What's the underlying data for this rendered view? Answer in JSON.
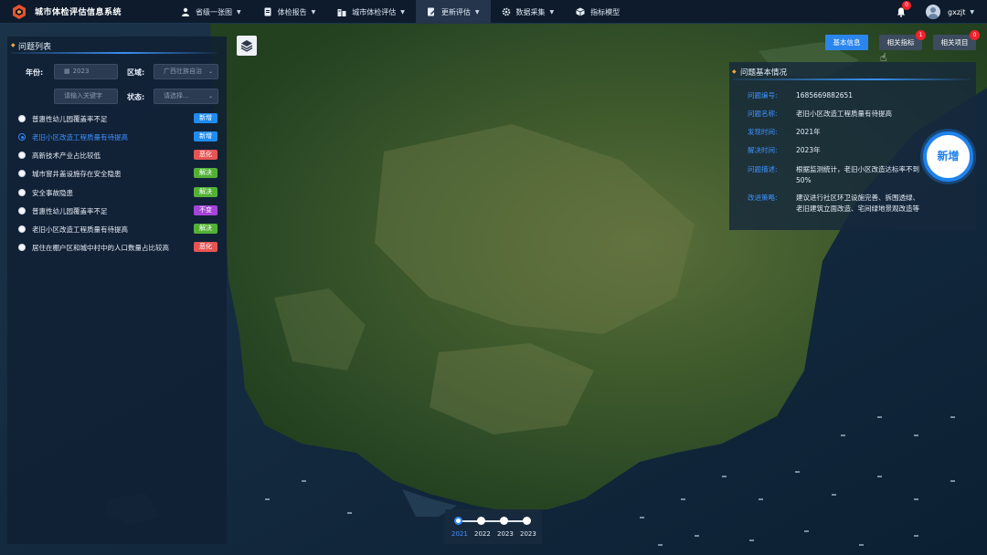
{
  "app": {
    "title": "城市体检评估信息系统"
  },
  "nav": {
    "items": [
      {
        "label": "省级一张图",
        "icon": "user-icon",
        "dropdown": true
      },
      {
        "label": "体检报告",
        "icon": "report-icon",
        "dropdown": true
      },
      {
        "label": "城市体检评估",
        "icon": "building-icon",
        "dropdown": true
      },
      {
        "label": "更新评估",
        "icon": "edit-icon",
        "dropdown": true,
        "active": true
      },
      {
        "label": "数据采集",
        "icon": "gear-icon",
        "dropdown": true
      },
      {
        "label": "指标模型",
        "icon": "cube-icon",
        "dropdown": false
      }
    ]
  },
  "user": {
    "notifications": "0",
    "name": "gxzjt"
  },
  "left_panel": {
    "title": "问题列表",
    "filters": {
      "year_label": "年份:",
      "year_value": "2023",
      "region_label": "区域:",
      "region_value": "广西壮族自治",
      "search_placeholder": "请输入关键字",
      "status_label": "状态:",
      "status_placeholder": "请选择..."
    },
    "issues": [
      {
        "text": "普惠性幼儿园覆盖率不足",
        "tag": "新增",
        "tag_type": "new",
        "selected": false
      },
      {
        "text": "老旧小区改造工程质量有待提高",
        "tag": "新增",
        "tag_type": "new",
        "selected": true
      },
      {
        "text": "高新技术产业占比较低",
        "tag": "恶化",
        "tag_type": "worse",
        "selected": false
      },
      {
        "text": "城市窨井盖设施存在安全隐患",
        "tag": "解决",
        "tag_type": "solved",
        "selected": false
      },
      {
        "text": "安全事故隐患",
        "tag": "解决",
        "tag_type": "solved",
        "selected": false
      },
      {
        "text": "普惠性幼儿园覆盖率不足",
        "tag": "不变",
        "tag_type": "same",
        "selected": false
      },
      {
        "text": "老旧小区改造工程质量有待提高",
        "tag": "解决",
        "tag_type": "solved",
        "selected": false
      },
      {
        "text": "居住在棚户区和城中村中的人口数量占比较高",
        "tag": "恶化",
        "tag_type": "worse",
        "selected": false
      }
    ]
  },
  "right_tabs": [
    {
      "label": "基本信息",
      "style": "primary",
      "badge": ""
    },
    {
      "label": "相关指标",
      "style": "dark",
      "badge": "1"
    },
    {
      "label": "相关项目",
      "style": "dark",
      "badge": "0"
    }
  ],
  "info": {
    "title": "问题基本情况",
    "rows": [
      {
        "key": "问题编号:",
        "value": "1685669882651"
      },
      {
        "key": "问题名称:",
        "value": "老旧小区改造工程质量有待提高"
      },
      {
        "key": "发现时间:",
        "value": "2021年"
      },
      {
        "key": "解决时间:",
        "value": "2023年"
      },
      {
        "key": "问题描述:",
        "value": "根据监测统计，老旧小区改造达标率不到50%"
      },
      {
        "key": "改进策略:",
        "value": "建议进行社区环卫设施完善、拆围透绿、老旧建筑立面改造、宅间绿地景观改造等"
      }
    ]
  },
  "add_button": {
    "label": "新增"
  },
  "timeline": {
    "years": [
      "2021",
      "2022",
      "2023",
      "2023"
    ],
    "active_index": 0
  },
  "colors": {
    "accent": "#2a86ec",
    "tag_new": "#1f8cf0",
    "tag_worse": "#e65454",
    "tag_solved": "#52b135",
    "tag_same": "#a444d8"
  }
}
